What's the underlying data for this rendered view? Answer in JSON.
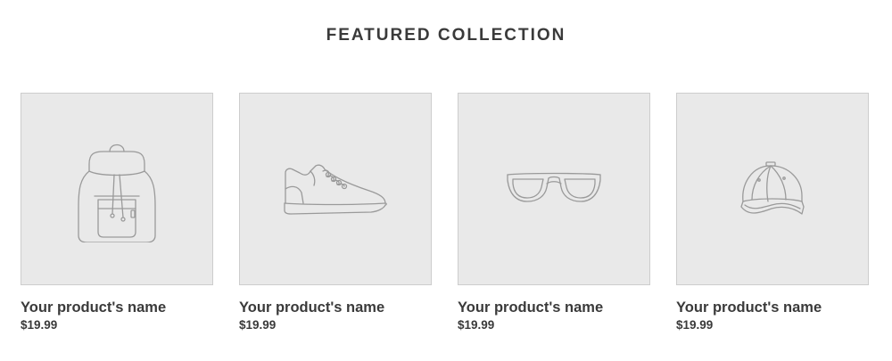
{
  "section": {
    "title": "FEATURED COLLECTION"
  },
  "products": [
    {
      "name": "Your product's name",
      "price": "$19.99",
      "icon": "backpack-icon"
    },
    {
      "name": "Your product's name",
      "price": "$19.99",
      "icon": "sneaker-icon"
    },
    {
      "name": "Your product's name",
      "price": "$19.99",
      "icon": "sunglasses-icon"
    },
    {
      "name": "Your product's name",
      "price": "$19.99",
      "icon": "cap-icon"
    }
  ],
  "colors": {
    "text": "#3a3a3a",
    "placeholder_bg": "#e9e9e9",
    "placeholder_border": "#cdcdcd",
    "illustration_stroke": "#9a9a9a"
  }
}
